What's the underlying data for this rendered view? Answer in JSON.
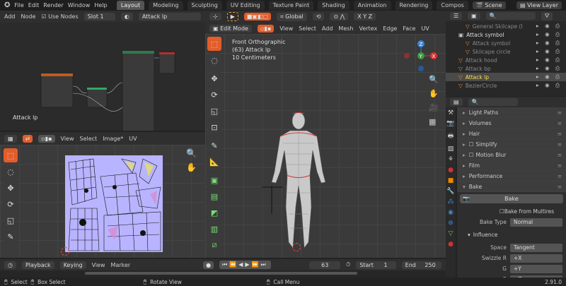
{
  "topbar": {
    "menus": [
      "File",
      "Edit",
      "Render",
      "Window",
      "Help"
    ],
    "workspaces": [
      "Layout",
      "Modeling",
      "Sculpting",
      "UV Editing",
      "Texture Paint",
      "Shading",
      "Animation",
      "Rendering",
      "Compos"
    ],
    "active_workspace": "Layout",
    "scene": "Scene",
    "view_layer": "View Layer"
  },
  "node_editor": {
    "menus": [
      "Add",
      "Node"
    ],
    "use_nodes": "Use Nodes",
    "slot": "Slot 1",
    "material": "Attack lp",
    "object_label": "Attack lp"
  },
  "viewport": {
    "mode": "Edit Mode",
    "orientation": "Global",
    "menus": [
      "View",
      "Select",
      "Add",
      "Mesh",
      "Vertex",
      "Edge",
      "Face",
      "UV"
    ],
    "overlay": [
      "Front Orthographic",
      "(63) Attack lp",
      "10 Centimeters"
    ],
    "axes": [
      "Z",
      "Y",
      "X"
    ]
  },
  "uv_editor": {
    "menus": [
      "View",
      "Select",
      "Image*",
      "UV"
    ]
  },
  "outliner": {
    "items": [
      {
        "name": "General Skilcape (I",
        "indent": 2,
        "dim": true
      },
      {
        "name": "Attack symbol",
        "indent": 1,
        "dim": false,
        "collection": true
      },
      {
        "name": "Attack symbol",
        "indent": 2,
        "dim": true
      },
      {
        "name": "Skilcape circle",
        "indent": 2,
        "dim": true
      },
      {
        "name": "Attack hood",
        "indent": 1,
        "dim": true
      },
      {
        "name": "Attack bp",
        "indent": 1,
        "dim": true
      },
      {
        "name": "Attack lp",
        "indent": 1,
        "dim": false,
        "active": true
      },
      {
        "name": "BezierCircle",
        "indent": 1,
        "dim": true
      }
    ]
  },
  "properties": {
    "panels": [
      "Light Paths",
      "Volumes",
      "Hair",
      "Simplify",
      "Motion Blur",
      "Film",
      "Performance",
      "Bake"
    ],
    "bake_button": "Bake",
    "bake_from_multires": "Bake from Multires",
    "bake_type_label": "Bake Type",
    "bake_type": "Normal",
    "influence": "Influence",
    "space_label": "Space",
    "space": "Tangent",
    "swizzle_r_label": "Swizzle R",
    "swizzle_r": "+X",
    "g_label": "G",
    "g": "+Y",
    "b_label": "B",
    "b": "+Z"
  },
  "timeline": {
    "menus": [
      "Playback",
      "Keying",
      "View",
      "Marker"
    ],
    "current_frame": "63",
    "start_label": "Start",
    "start": "1",
    "end_label": "End",
    "end": "250"
  },
  "statusbar": {
    "items": [
      "Select",
      "Box Select",
      "Rotate View",
      "Call Menu"
    ],
    "version": "2.91.0"
  },
  "colors": {
    "accent": "#e25d2a",
    "active_text": "#ffe24a",
    "uv_bg": "#b9b4ff"
  }
}
